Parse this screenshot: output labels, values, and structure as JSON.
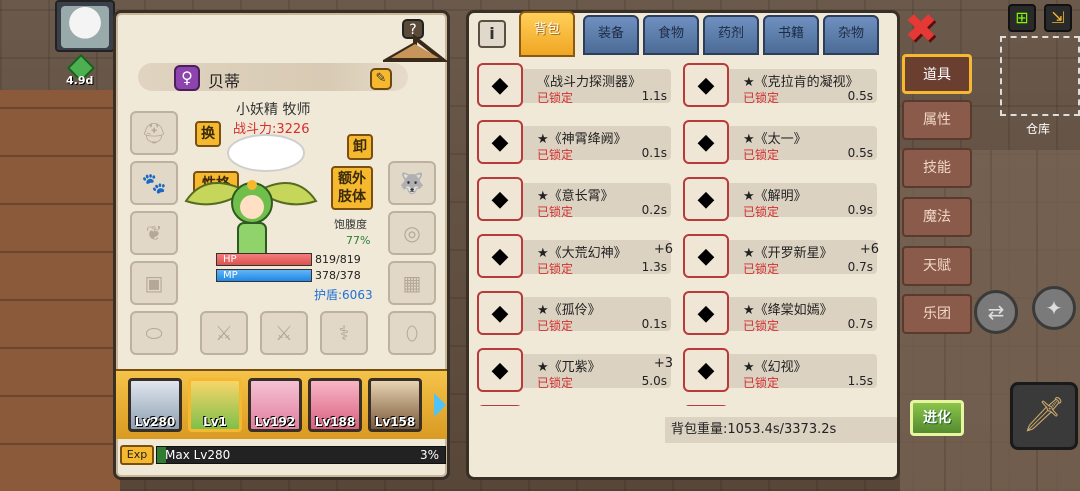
{
  "hud": {
    "player_level": "4.9d"
  },
  "character": {
    "name": "贝蒂",
    "gender_icon": "female-icon",
    "class": "小妖精 牧师",
    "combat_power": "战斗力:3226",
    "buttons": {
      "swap": "换",
      "personality": "性格",
      "unequip": "卸",
      "extra_body_line1": "额外",
      "extra_body_line2": "肢体"
    },
    "satiety_label": "饱腹度",
    "satiety_value": "77%",
    "hp_label": "HP",
    "hp_value": "819/819",
    "mp_label": "MP",
    "mp_value": "378/378",
    "shield": "护盾:6063"
  },
  "party": [
    {
      "label": "Lv280"
    },
    {
      "label": "Lv1"
    },
    {
      "label": "Lv192"
    },
    {
      "label": "Lv188"
    },
    {
      "label": "Lv158"
    }
  ],
  "exp": {
    "tag": "Exp",
    "text": "Max Lv280",
    "percent": "3%",
    "fill_fraction": 0.03
  },
  "inventory": {
    "info_label": "i",
    "tabs": [
      "背包",
      "装备",
      "食物",
      "药剂",
      "书籍",
      "杂物"
    ],
    "active_tab": "背包",
    "items": [
      {
        "name": "《战斗力探测器》",
        "lock": "已锁定",
        "weight": "1.1s",
        "icon": "scanner-icon"
      },
      {
        "name": "★《克拉肯的凝视》",
        "lock": "已锁定",
        "weight": "0.5s",
        "icon": "goggles-icon"
      },
      {
        "name": "★《神霄绛阙》",
        "lock": "已锁定",
        "weight": "0.1s",
        "icon": "amulet-icon"
      },
      {
        "name": "★《太一》",
        "lock": "已锁定",
        "weight": "0.5s",
        "icon": "wing-icon"
      },
      {
        "name": "★《意长霄》",
        "lock": "已锁定",
        "weight": "0.2s",
        "icon": "ring-icon"
      },
      {
        "name": "★《解明》",
        "lock": "已锁定",
        "weight": "0.9s",
        "icon": "cape-icon"
      },
      {
        "name": "★《大荒幻神》",
        "plus": "+6",
        "lock": "已锁定",
        "weight": "1.3s",
        "icon": "dagger-icon"
      },
      {
        "name": "★《开罗新星》",
        "plus": "+6",
        "lock": "已锁定",
        "weight": "0.7s",
        "icon": "sword-icon"
      },
      {
        "name": "★《孤伶》",
        "lock": "已锁定",
        "weight": "0.1s",
        "icon": "gold-ring-icon"
      },
      {
        "name": "★《绛棠如嫣》",
        "lock": "已锁定",
        "weight": "0.7s",
        "icon": "orb-icon"
      },
      {
        "name": "★《兀紫》",
        "plus": "+3",
        "lock": "已锁定",
        "weight": "5.0s",
        "icon": "gauntlet-icon"
      },
      {
        "name": "★《幻视》",
        "lock": "已锁定",
        "weight": "1.5s",
        "icon": "visor-icon"
      }
    ],
    "weight": "背包重量:1053.4s/3373.2s"
  },
  "side_tabs": [
    "道具",
    "属性",
    "技能",
    "魔法",
    "天赋",
    "乐团"
  ],
  "active_side_tab": "道具",
  "right_hud": {
    "warehouse": "仓库",
    "evolve": "进化"
  },
  "colors": {
    "accent": "#f5b82e",
    "lock_red": "#d32f2f",
    "panel_bg": "#f1e9d8",
    "tab_blue": "#4c6b96"
  }
}
